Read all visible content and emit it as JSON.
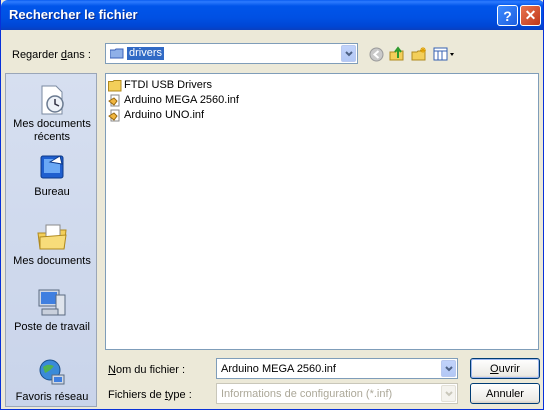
{
  "window": {
    "title": "Rechercher le fichier"
  },
  "toolbar": {
    "lookin_prefix": "Regarder ",
    "lookin_accel": "d",
    "lookin_suffix": "ans :",
    "current_folder": "drivers"
  },
  "places": [
    {
      "label": "Mes documents récents",
      "icon": "recent-documents-icon"
    },
    {
      "label": "Bureau",
      "icon": "desktop-icon"
    },
    {
      "label": "Mes documents",
      "icon": "my-documents-icon"
    },
    {
      "label": "Poste de travail",
      "icon": "my-computer-icon"
    },
    {
      "label": "Favoris réseau",
      "icon": "network-places-icon"
    }
  ],
  "files": [
    {
      "name": "FTDI USB Drivers",
      "type": "folder"
    },
    {
      "name": "Arduino MEGA 2560.inf",
      "type": "inf"
    },
    {
      "name": "Arduino UNO.inf",
      "type": "inf"
    }
  ],
  "filename": {
    "label_accel": "N",
    "label_rest": "om du fichier :",
    "value": "Arduino MEGA 2560.inf"
  },
  "filetype": {
    "label_prefix": "Fichiers de ",
    "label_accel": "t",
    "label_suffix": "ype :",
    "value": "Informations de configuration (*.inf)"
  },
  "buttons": {
    "open_accel": "O",
    "open_rest": "uvrir",
    "cancel": "Annuler"
  },
  "colors": {
    "titlebar": "#0055ea",
    "selection": "#316ac5",
    "dialog_bg": "#ece9d8"
  }
}
